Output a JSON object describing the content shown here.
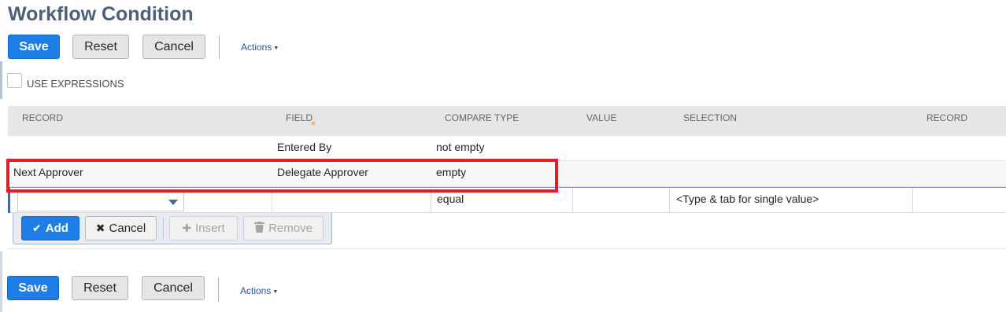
{
  "page": {
    "title": "Workflow Condition"
  },
  "top_toolbar": {
    "save_label": "Save",
    "reset_label": "Reset",
    "cancel_label": "Cancel",
    "actions_label": "Actions"
  },
  "options": {
    "use_expressions_label": "USE EXPRESSIONS",
    "use_expressions_checked": false
  },
  "grid": {
    "columns": [
      "RECORD",
      "FIELD",
      "COMPARE TYPE",
      "VALUE",
      "SELECTION",
      "RECORD"
    ],
    "required_marker": "*",
    "rows": [
      {
        "record": "",
        "field": "Entered By",
        "compare_type": "not empty",
        "value": "",
        "selection": ""
      },
      {
        "record": "Next Approver",
        "field": "Delegate Approver",
        "compare_type": "empty",
        "value": "",
        "selection": ""
      }
    ],
    "edit_row": {
      "record_value": "",
      "field_value": "",
      "compare_type": "equal",
      "value": "",
      "selection_placeholder": "<Type & tab for single value>"
    }
  },
  "edit_toolbar": {
    "add_label": "Add",
    "cancel_label": "Cancel",
    "insert_label": "Insert",
    "remove_label": "Remove"
  },
  "bottom_toolbar": {
    "save_label": "Save",
    "reset_label": "Reset",
    "cancel_label": "Cancel",
    "actions_label": "Actions"
  },
  "colors": {
    "primary": "#1e7ee6",
    "title": "#4d5f79",
    "highlight": "#e01f26",
    "required": "#e8a440"
  }
}
